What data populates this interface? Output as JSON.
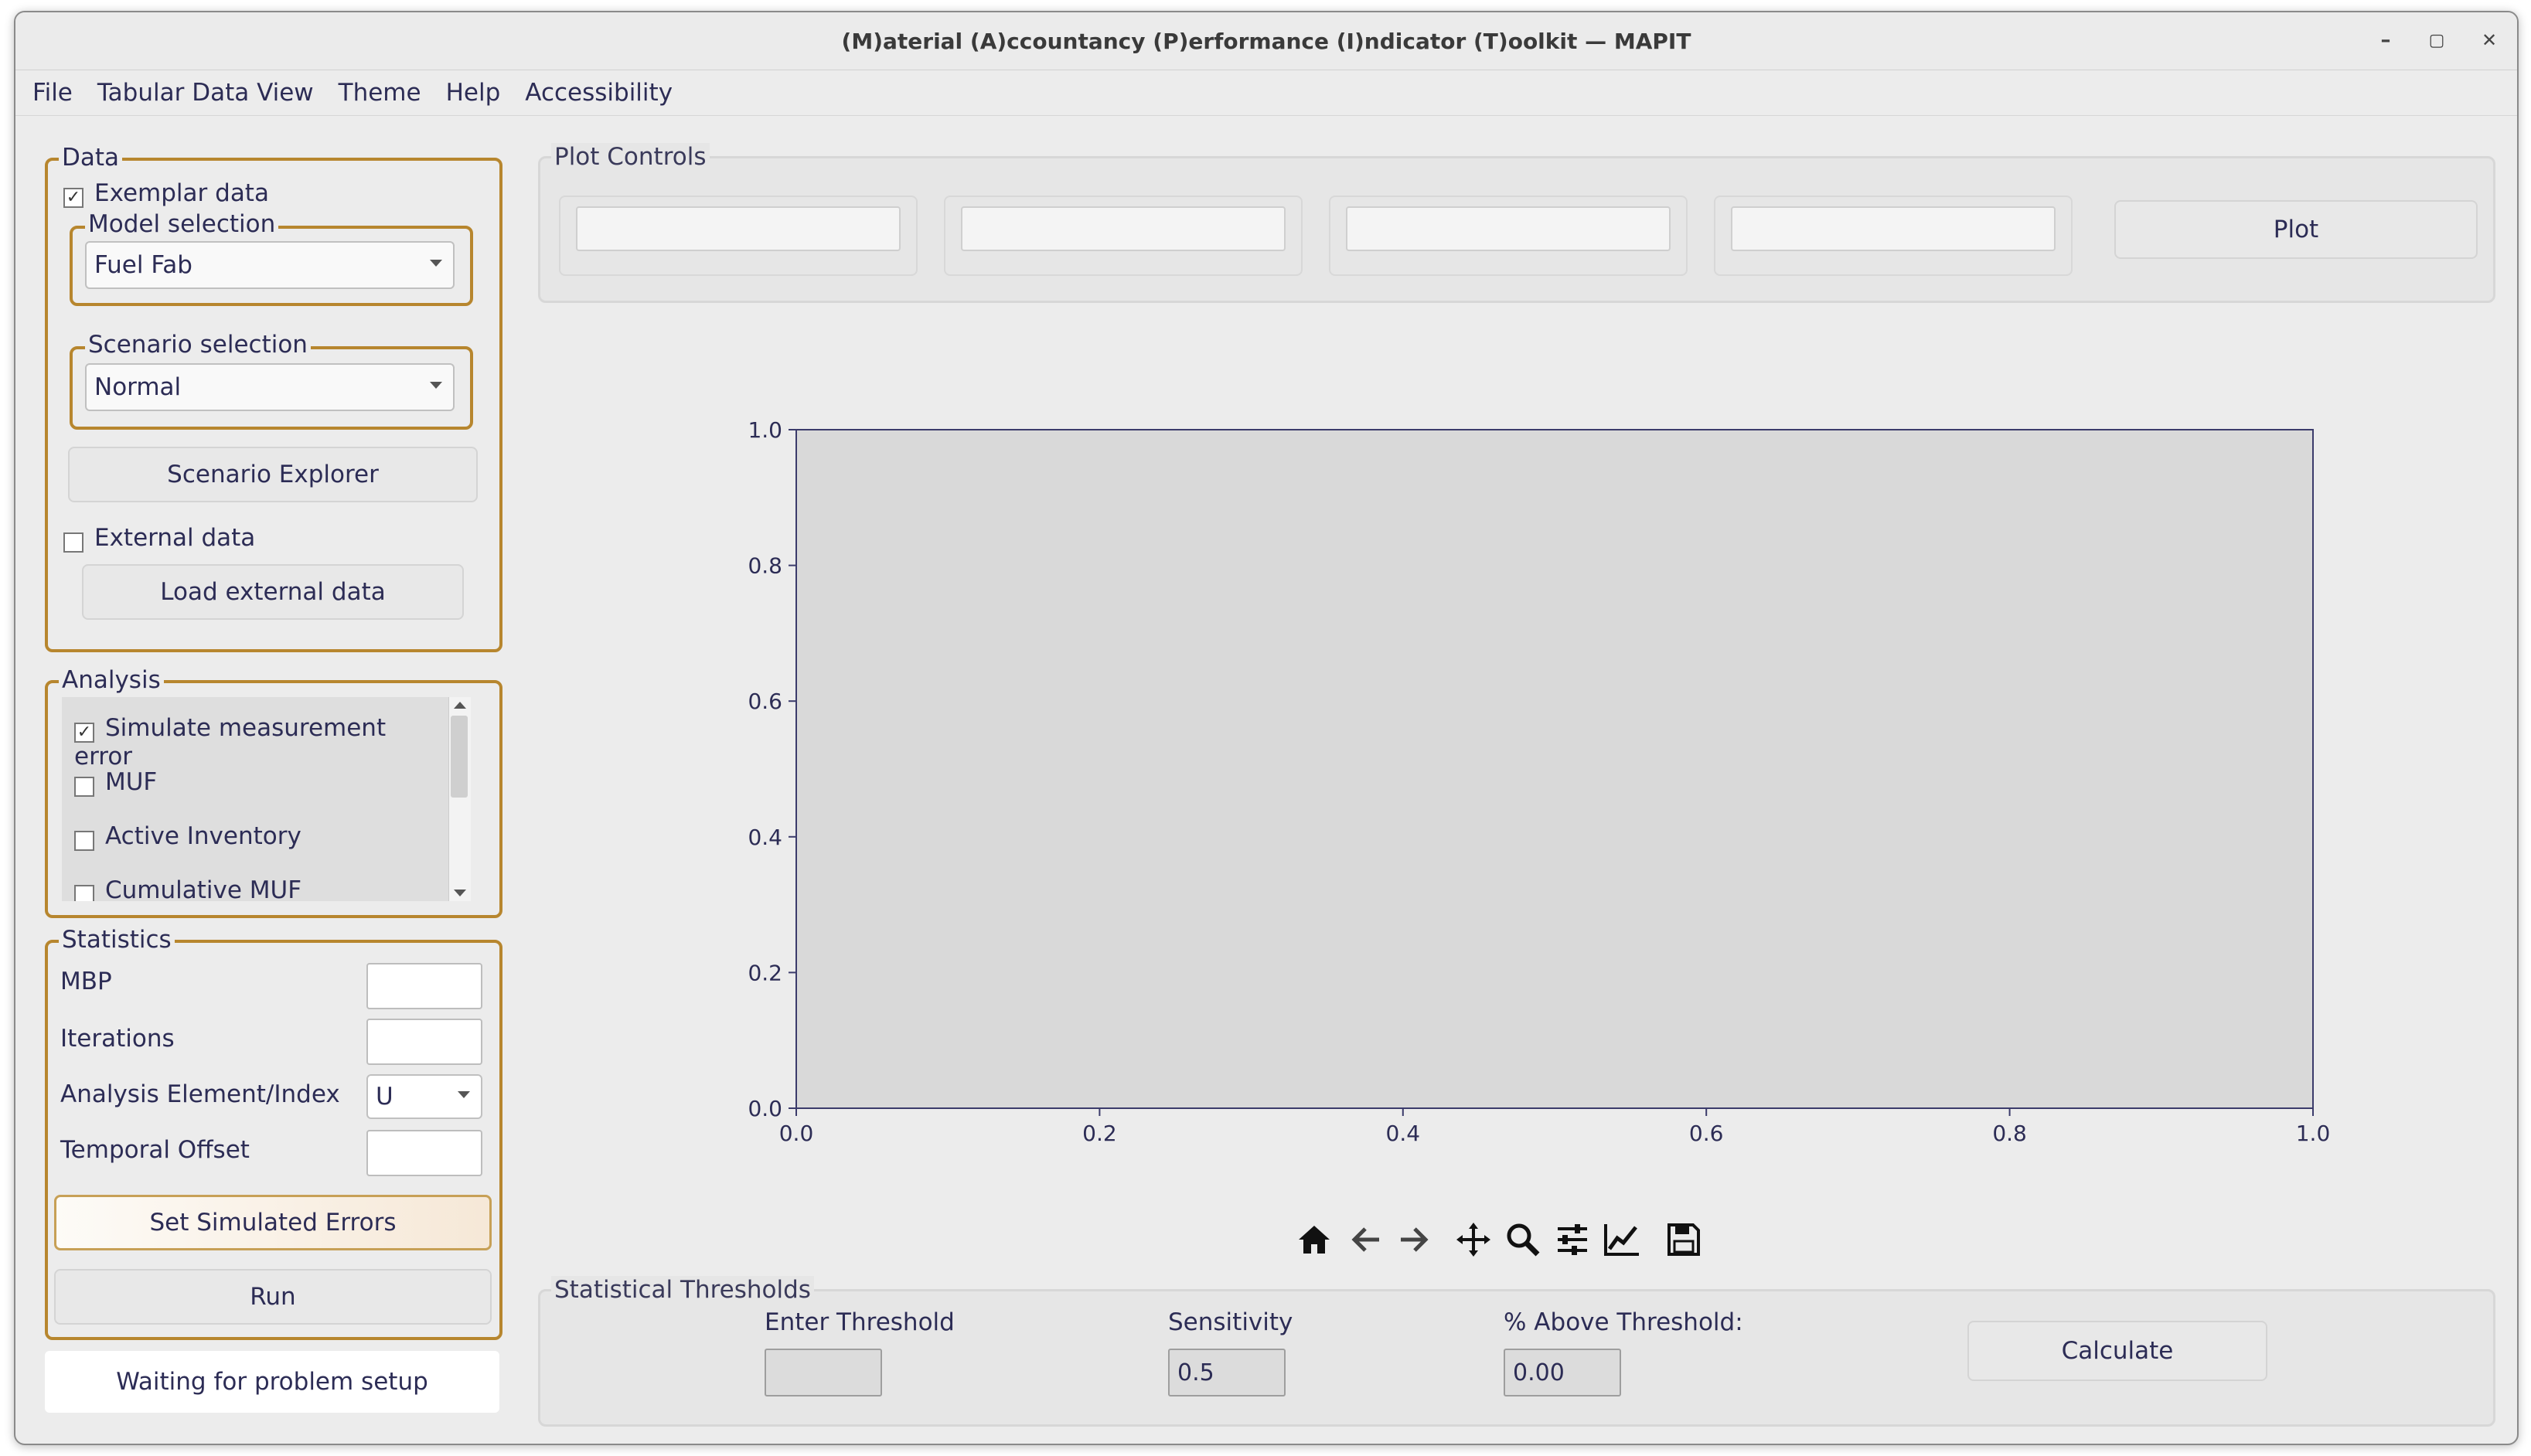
{
  "window": {
    "title": "(M)aterial (A)ccountancy (P)erformance (I)ndicator (T)oolkit — MAPIT",
    "controls": {
      "minimize": "–",
      "maximize": "▢",
      "close": "✕"
    }
  },
  "menu": [
    "File",
    "Tabular Data View",
    "Theme",
    "Help",
    "Accessibility"
  ],
  "data_group": {
    "title": "Data",
    "exemplar_label": "Exemplar data",
    "exemplar_checked": true,
    "model_selection_title": "Model selection",
    "model_value": "Fuel Fab",
    "scenario_selection_title": "Scenario selection",
    "scenario_value": "Normal",
    "scenario_explorer_label": "Scenario Explorer",
    "external_label": "External data",
    "external_checked": false,
    "load_external_label": "Load external data"
  },
  "analysis_group": {
    "title": "Analysis",
    "items": [
      {
        "label": "Simulate measurement error",
        "checked": true
      },
      {
        "label": "MUF",
        "checked": false
      },
      {
        "label": "Active Inventory",
        "checked": false
      },
      {
        "label": "Cumulative MUF",
        "checked": false
      }
    ]
  },
  "statistics_group": {
    "title": "Statistics",
    "mbp_label": "MBP",
    "iterations_label": "Iterations",
    "element_label": "Analysis Element/Index",
    "element_value": "U",
    "temporal_label": "Temporal Offset",
    "set_errors_label": "Set Simulated Errors",
    "run_label": "Run"
  },
  "status_text": "Waiting for problem setup",
  "plot_controls": {
    "title": "Plot Controls",
    "plot_button_label": "Plot"
  },
  "chart_data": {
    "type": "line",
    "x": [],
    "series": [],
    "xlim": [
      0.0,
      1.0
    ],
    "ylim": [
      0.0,
      1.0
    ],
    "xticks": [
      "0.0",
      "0.2",
      "0.4",
      "0.6",
      "0.8",
      "1.0"
    ],
    "yticks": [
      "0.0",
      "0.2",
      "0.4",
      "0.6",
      "0.8",
      "1.0"
    ],
    "title": "",
    "xlabel": "",
    "ylabel": "",
    "colors": {
      "plot_bg": "#d9d9d9",
      "axis": "#3b3b6b"
    }
  },
  "toolbar_icons": [
    "home-icon",
    "back-arrow-icon",
    "forward-arrow-icon",
    "pan-icon",
    "zoom-icon",
    "configure-subplots-icon",
    "edit-axes-icon",
    "save-icon"
  ],
  "thresholds": {
    "title": "Statistical Thresholds",
    "enter_threshold_label": "Enter Threshold",
    "enter_threshold_value": "",
    "sensitivity_label": "Sensitivity",
    "sensitivity_value": "0.5",
    "above_threshold_label": "% Above Threshold:",
    "above_threshold_value": "0.00",
    "calculate_label": "Calculate"
  },
  "colors": {
    "accent": "#b7862e",
    "text": "#2c2c55",
    "window_bg": "#ececec"
  }
}
